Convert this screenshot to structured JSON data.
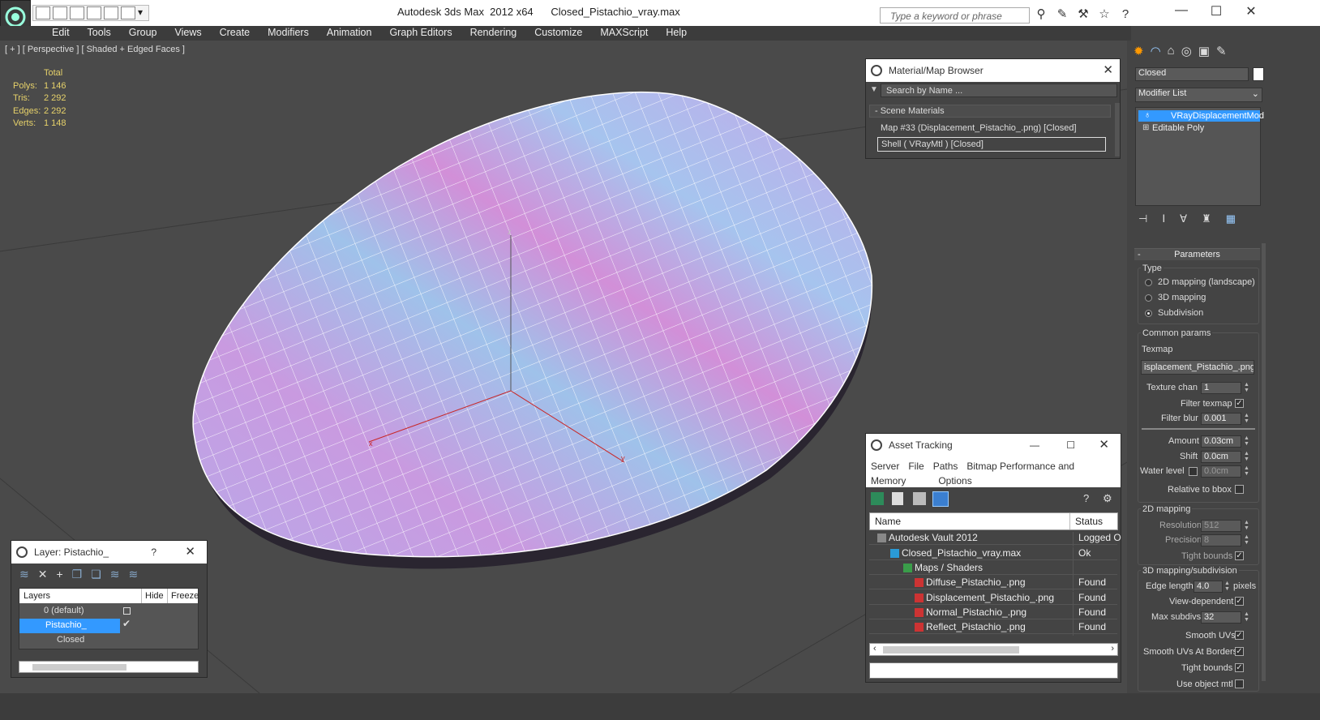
{
  "titlebar": {
    "app": "Autodesk 3ds Max  2012 x64",
    "file": "Closed_Pistachio_vray.max",
    "search_placeholder": "Type a keyword or phrase"
  },
  "menu": [
    "Edit",
    "Tools",
    "Group",
    "Views",
    "Create",
    "Modifiers",
    "Animation",
    "Graph Editors",
    "Rendering",
    "Customize",
    "MAXScript",
    "Help"
  ],
  "viewport": {
    "label": "[ + ] [ Perspective ] [ Shaded + Edged Faces ]",
    "stats_header": "Total",
    "stats": [
      {
        "k": "Polys:",
        "v": "1 146"
      },
      {
        "k": "Tris:",
        "v": "2 292"
      },
      {
        "k": "Edges:",
        "v": "2 292"
      },
      {
        "k": "Verts:",
        "v": "1 148"
      }
    ],
    "axis": {
      "x": "x",
      "y": "y",
      "z": "z"
    }
  },
  "material_browser": {
    "title": "Material/Map Browser",
    "search": "Search by Name ...",
    "section": "- Scene Materials",
    "items": [
      "Map #33 (Displacement_Pistachio_.png) [Closed]",
      "Shell  ( VRayMtl ) [Closed]"
    ]
  },
  "asset_tracking": {
    "title": "Asset Tracking",
    "menu": [
      "Server",
      "File",
      "Paths",
      "Bitmap Performance and Memory",
      "Options"
    ],
    "col_name": "Name",
    "col_status": "Status",
    "rows": [
      {
        "name": "Autodesk Vault 2012",
        "status": "Logged Ou",
        "indent": 24
      },
      {
        "name": "Closed_Pistachio_vray.max",
        "status": "Ok",
        "indent": 40
      },
      {
        "name": "Maps / Shaders",
        "status": "",
        "indent": 56
      },
      {
        "name": "Diffuse_Pistachio_.png",
        "status": "Found",
        "indent": 70
      },
      {
        "name": "Displacement_Pistachio_.png",
        "status": "Found",
        "indent": 70
      },
      {
        "name": "Normal_Pistachio_.png",
        "status": "Found",
        "indent": 70
      },
      {
        "name": "Reflect_Pistachio_.png",
        "status": "Found",
        "indent": 70
      }
    ]
  },
  "layer_panel": {
    "title": "Layer: Pistachio_",
    "help": "?",
    "col_layers": "Layers",
    "col_hide": "Hide",
    "col_freeze": "Freeze",
    "rows": [
      "0 (default)",
      "Pistachio_",
      "Closed"
    ]
  },
  "command_panel": {
    "object_name": "Closed",
    "modifier_list": "Modifier List",
    "stack": [
      "VRayDisplacementMod",
      "Editable Poly"
    ],
    "rollout": "Parameters",
    "type_label": "Type",
    "types": [
      "2D mapping (landscape)",
      "3D mapping",
      "Subdivision"
    ],
    "common_params": "Common params",
    "texmap_label": "Texmap",
    "texmap_value": "isplacement_Pistachio_.png)",
    "texture_chan_label": "Texture chan",
    "texture_chan": "1",
    "filter_texmap": "Filter texmap",
    "filter_blur_label": "Filter blur",
    "filter_blur": "0.001",
    "amount_label": "Amount",
    "amount": "0.03cm",
    "shift_label": "Shift",
    "shift": "0.0cm",
    "water_level_label": "Water level",
    "water_level": "0.0cm",
    "relative_bbox": "Relative to bbox",
    "mapping2d": "2D mapping",
    "resolution_label": "Resolution",
    "resolution": "512",
    "precision_label": "Precision",
    "precision": "8",
    "tight_bounds": "Tight bounds",
    "mapping3d": "3D mapping/subdivision",
    "edge_length_label": "Edge length",
    "edge_length": "4.0",
    "pixels": "pixels",
    "view_dependent": "View-dependent",
    "max_subdivs_label": "Max subdivs",
    "max_subdivs": "32",
    "smooth_uvs": "Smooth UVs",
    "smooth_uvs_borders": "Smooth UVs At Borders",
    "tight_bounds2": "Tight bounds",
    "use_object_mtl": "Use object mtl"
  },
  "colors": {
    "viewport": "#4a4a4a",
    "panel": "#444444",
    "accent": "#3399ff",
    "stats": "#e6d16a"
  }
}
